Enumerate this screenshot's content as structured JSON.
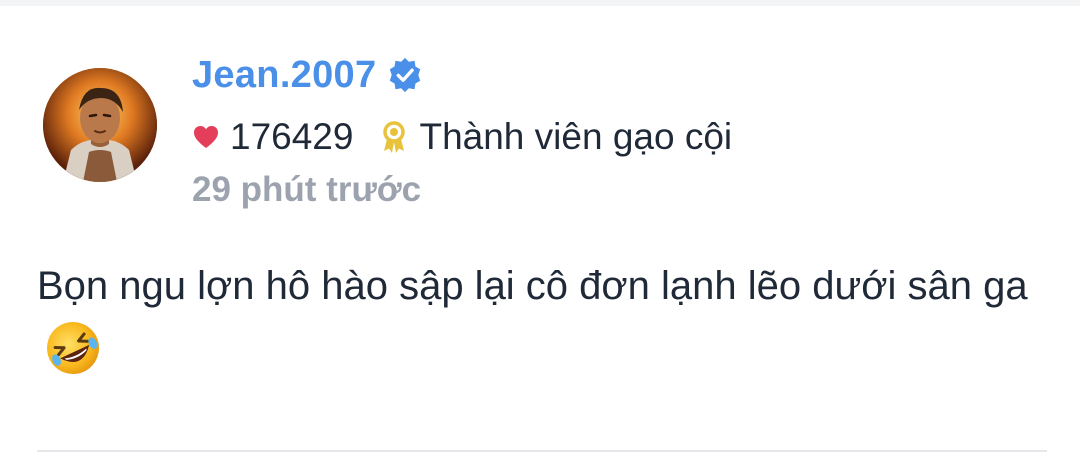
{
  "post": {
    "author": {
      "username": "Jean.2007",
      "verified": true
    },
    "stats": {
      "likes": "176429",
      "rank": "Thành viên gạo cội"
    },
    "time_ago": "29 phút trước",
    "text": "Bọn ngu lợn hô hào sập lại cô đơn lạnh lẽo dưới sân ga",
    "emoji_icon": "rolling-on-floor-laughing-emoji"
  },
  "colors": {
    "username": "#4a8fe8",
    "verified_badge": "#4a8fe8",
    "heart": "#e53e5a",
    "award": "#e8c23a",
    "timestamp": "#9ca3af",
    "text": "#1f2937"
  }
}
